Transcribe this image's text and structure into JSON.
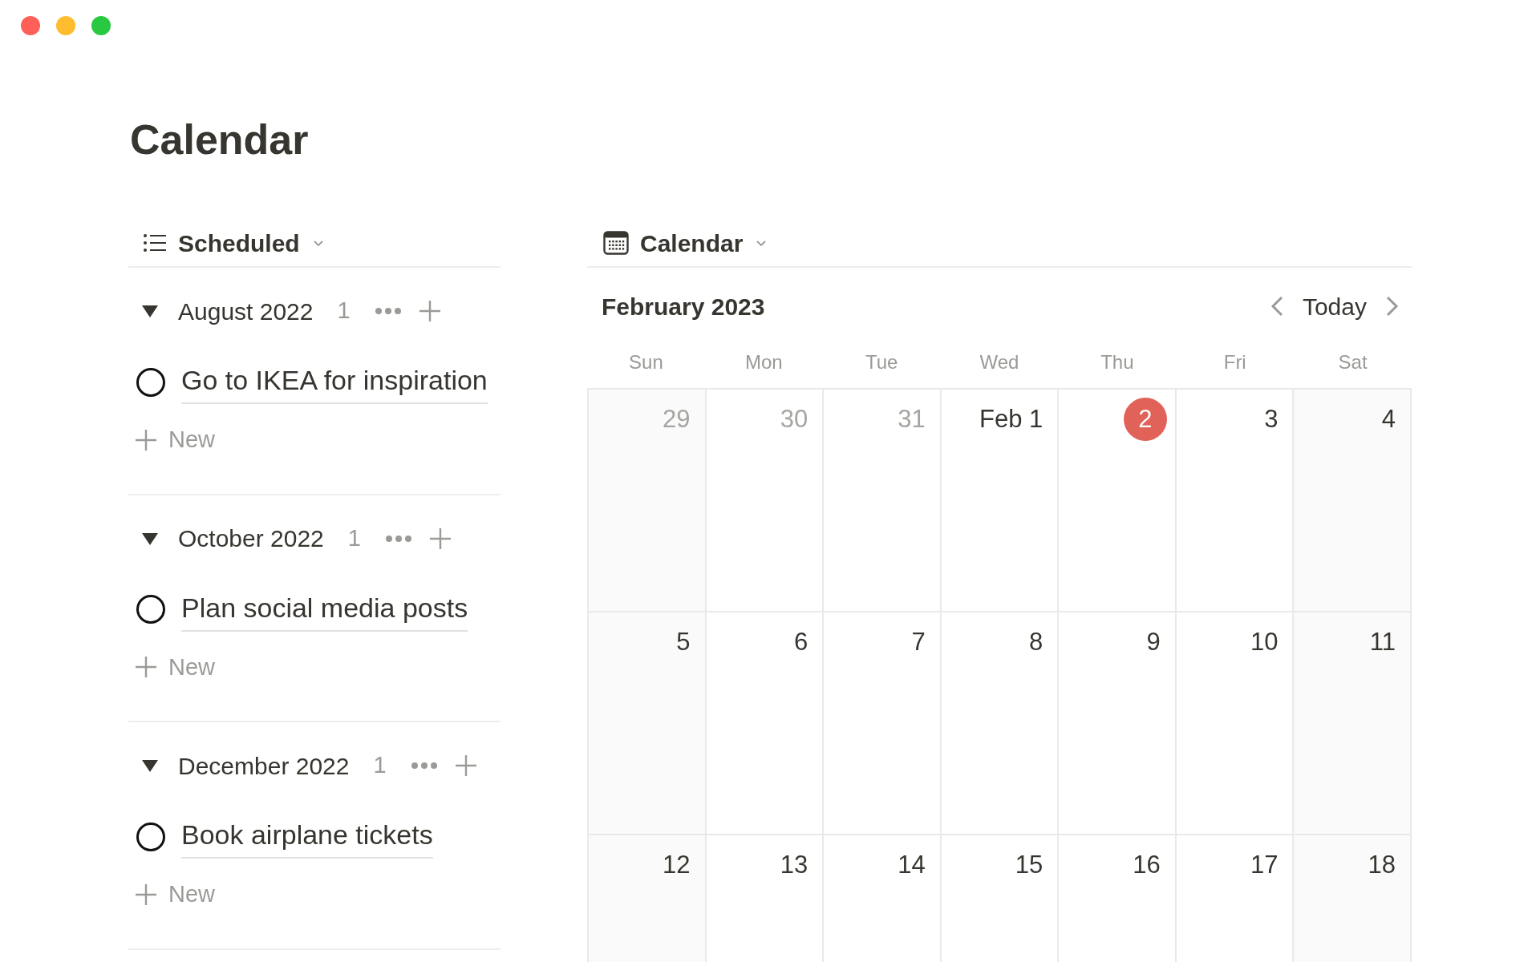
{
  "page_title": "Calendar",
  "list_view": {
    "title": "Scheduled",
    "groups": [
      {
        "title": "August 2022",
        "count": "1",
        "expanded": true,
        "items": [
          {
            "title": "Go to IKEA for inspiration",
            "done": false
          }
        ],
        "new_label": "New"
      },
      {
        "title": "October 2022",
        "count": "1",
        "expanded": true,
        "items": [
          {
            "title": "Plan social media posts",
            "done": false
          }
        ],
        "new_label": "New"
      },
      {
        "title": "December 2022",
        "count": "1",
        "expanded": true,
        "items": [
          {
            "title": "Book airplane tickets",
            "done": false
          }
        ],
        "new_label": "New"
      }
    ]
  },
  "calendar_view": {
    "title": "Calendar",
    "month": "February 2023",
    "today_label": "Today",
    "weekdays": [
      "Sun",
      "Mon",
      "Tue",
      "Wed",
      "Thu",
      "Fri",
      "Sat"
    ],
    "days": [
      {
        "label": "29",
        "in_month": false,
        "today": false
      },
      {
        "label": "30",
        "in_month": false,
        "today": false
      },
      {
        "label": "31",
        "in_month": false,
        "today": false
      },
      {
        "label": "Feb 1",
        "in_month": true,
        "today": false
      },
      {
        "label": "2",
        "in_month": true,
        "today": true
      },
      {
        "label": "3",
        "in_month": true,
        "today": false
      },
      {
        "label": "4",
        "in_month": true,
        "today": false
      },
      {
        "label": "5",
        "in_month": true,
        "today": false
      },
      {
        "label": "6",
        "in_month": true,
        "today": false
      },
      {
        "label": "7",
        "in_month": true,
        "today": false
      },
      {
        "label": "8",
        "in_month": true,
        "today": false
      },
      {
        "label": "9",
        "in_month": true,
        "today": false
      },
      {
        "label": "10",
        "in_month": true,
        "today": false
      },
      {
        "label": "11",
        "in_month": true,
        "today": false
      },
      {
        "label": "12",
        "in_month": true,
        "today": false
      },
      {
        "label": "13",
        "in_month": true,
        "today": false
      },
      {
        "label": "14",
        "in_month": true,
        "today": false
      },
      {
        "label": "15",
        "in_month": true,
        "today": false
      },
      {
        "label": "16",
        "in_month": true,
        "today": false
      },
      {
        "label": "17",
        "in_month": true,
        "today": false
      },
      {
        "label": "18",
        "in_month": true,
        "today": false
      }
    ]
  }
}
